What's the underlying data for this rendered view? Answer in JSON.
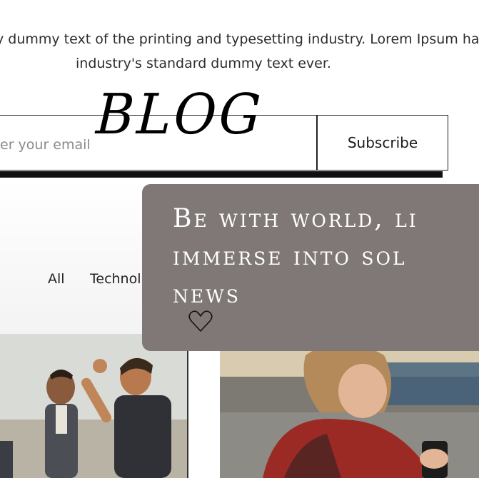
{
  "intro": {
    "line1": "y dummy text of the printing and typesetting industry. Lorem Ipsum has",
    "line2": "industry's standard dummy text ever."
  },
  "subscribe": {
    "email_placeholder": "er your email",
    "button_label": "Subscribe"
  },
  "logo": {
    "text": "BLOG"
  },
  "filters": {
    "all_label": "All",
    "tech_label": "Technol"
  },
  "overlay": {
    "line1": "Be with world, li",
    "line2": "immerse into sol",
    "line3": "news",
    "icon": "heart-outline-icon",
    "background": "#7f7876"
  }
}
